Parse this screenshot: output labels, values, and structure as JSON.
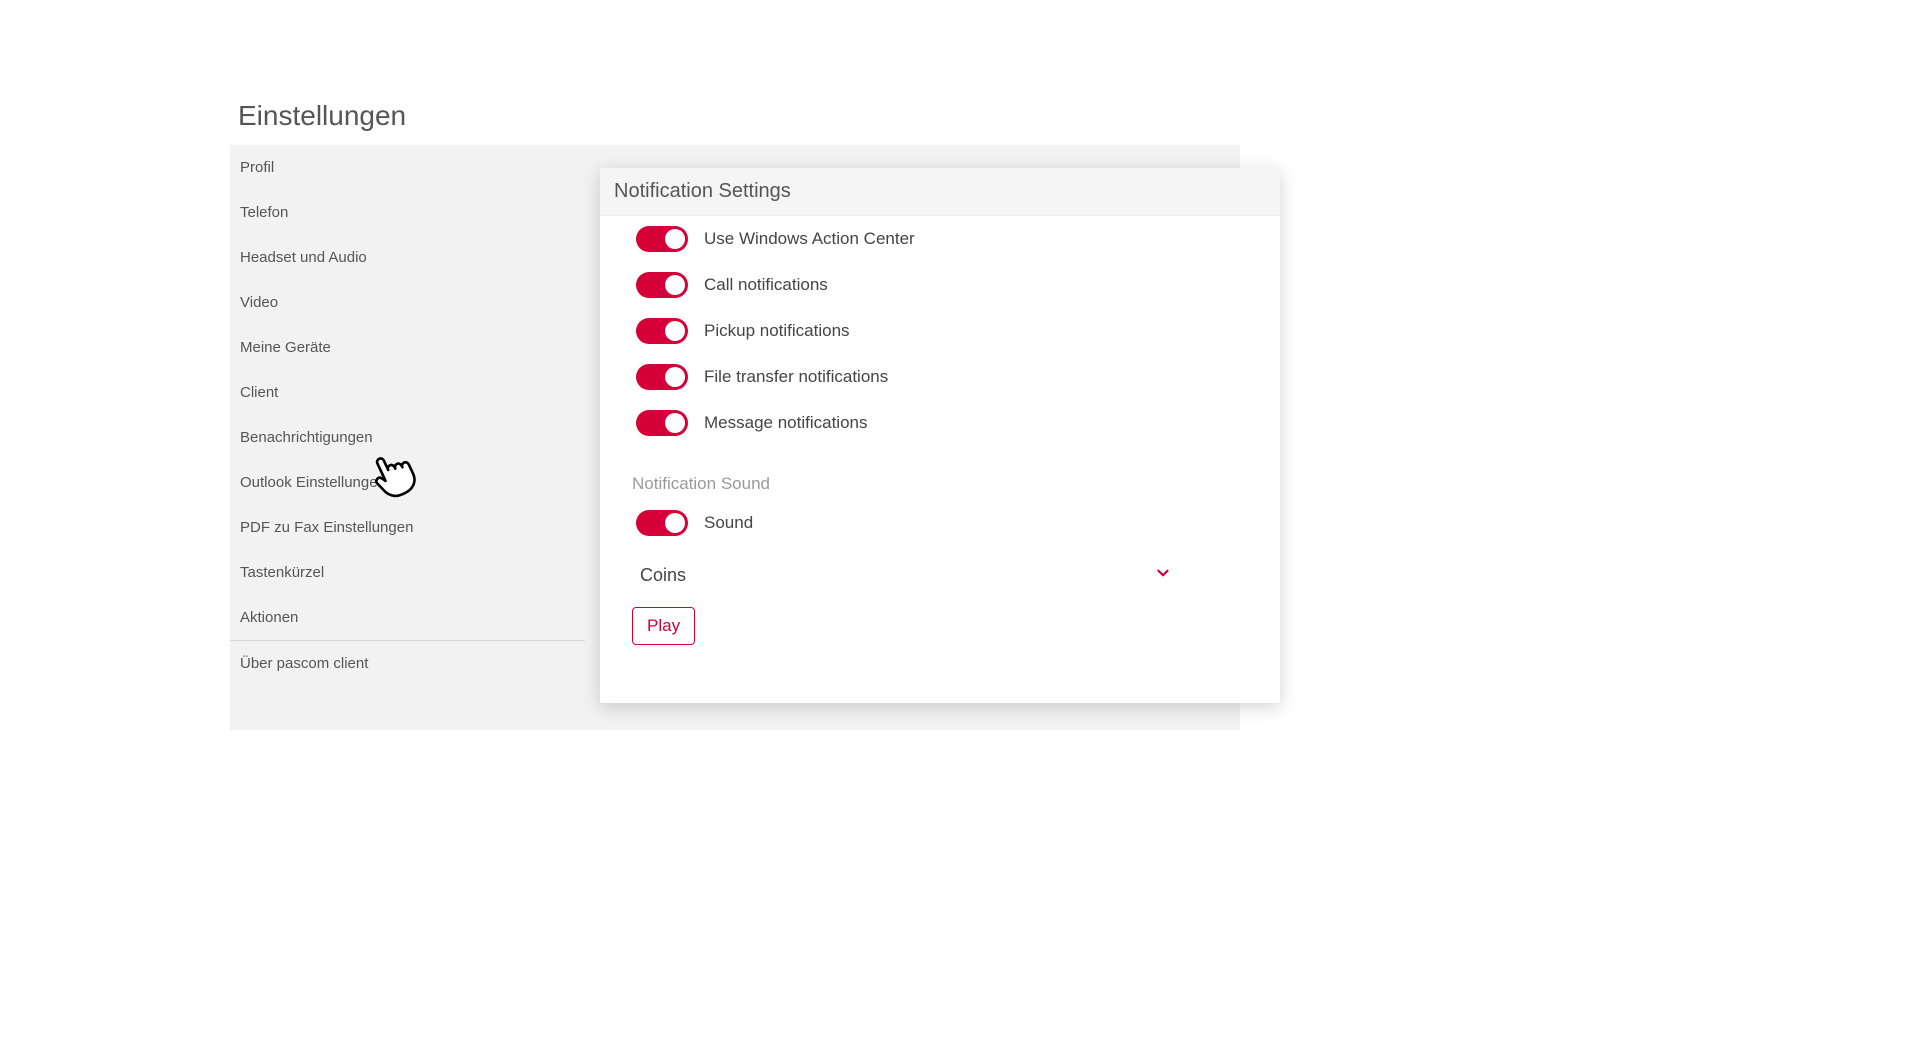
{
  "page_title": "Einstellungen",
  "colors": {
    "accent": "#d50037"
  },
  "sidebar": {
    "items": [
      {
        "label": "Profil"
      },
      {
        "label": "Telefon"
      },
      {
        "label": "Headset und Audio"
      },
      {
        "label": "Video"
      },
      {
        "label": "Meine Geräte"
      },
      {
        "label": "Client"
      },
      {
        "label": "Benachrichtigungen"
      },
      {
        "label": "Outlook Einstellungen"
      },
      {
        "label": "PDF zu Fax Einstellungen"
      },
      {
        "label": "Tastenkürzel"
      },
      {
        "label": "Aktionen"
      },
      {
        "label": "Über pascom client"
      }
    ]
  },
  "panel": {
    "title": "Notification Settings",
    "toggles": [
      {
        "label": "Use Windows Action Center",
        "on": true
      },
      {
        "label": "Call notifications",
        "on": true
      },
      {
        "label": "Pickup notifications",
        "on": true
      },
      {
        "label": "File transfer notifications",
        "on": true
      },
      {
        "label": "Message notifications",
        "on": true
      }
    ],
    "sound_section_label": "Notification Sound",
    "sound_toggle": {
      "label": "Sound",
      "on": true
    },
    "sound_dropdown": {
      "value": "Coins"
    },
    "play_button": "Play"
  }
}
